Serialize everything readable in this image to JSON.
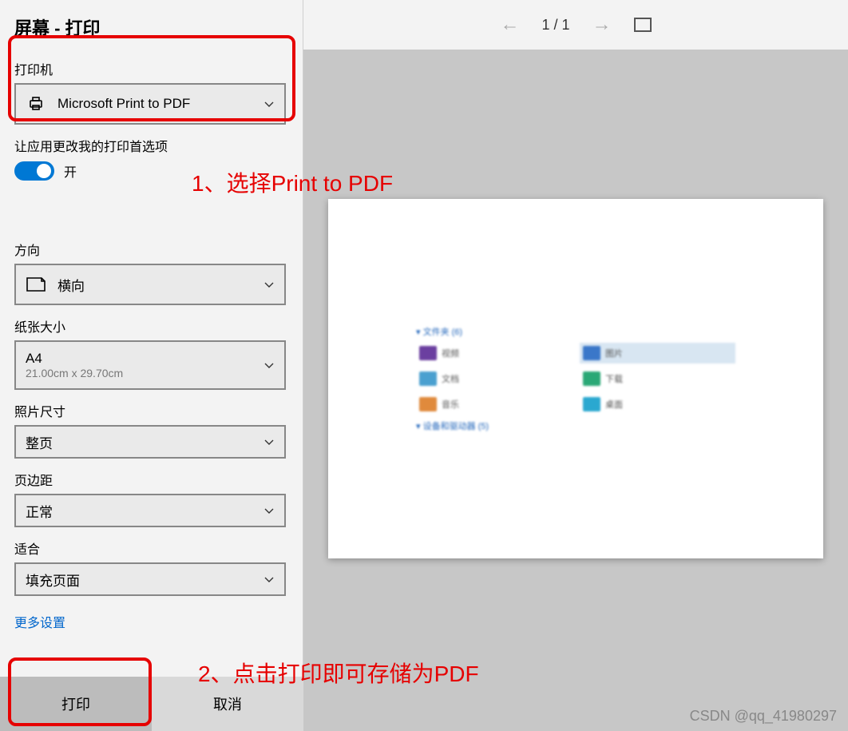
{
  "window": {
    "title": "屏幕 - 打印",
    "close_icon": "×"
  },
  "left": {
    "printer_label": "打印机",
    "printer_value": "Microsoft Print to PDF",
    "allow_change_label": "让应用更改我的打印首选项",
    "toggle_value": "开",
    "orientation_label": "方向",
    "orientation_value": "横向",
    "paper_label": "纸张大小",
    "paper_value": "A4",
    "paper_sub": "21.00cm x 29.70cm",
    "photo_label": "照片尺寸",
    "photo_value": "整页",
    "margin_label": "页边距",
    "margin_value": "正常",
    "fit_label": "适合",
    "fit_value": "填充页面",
    "more_link": "更多设置"
  },
  "footer": {
    "print": "打印",
    "cancel": "取消"
  },
  "preview": {
    "page_indicator": "1  /  1",
    "folders_header": "文件夹 (6)",
    "devices_header": "设备和驱动器 (5)",
    "items": {
      "video": "视频",
      "pictures": "图片",
      "documents": "文档",
      "downloads": "下载",
      "music": "音乐",
      "desktop": "桌面"
    }
  },
  "annotations": {
    "a1": "1、选择Print  to PDF",
    "a2": "2、点击打印即可存储为PDF"
  },
  "watermark": "CSDN @qq_41980297"
}
